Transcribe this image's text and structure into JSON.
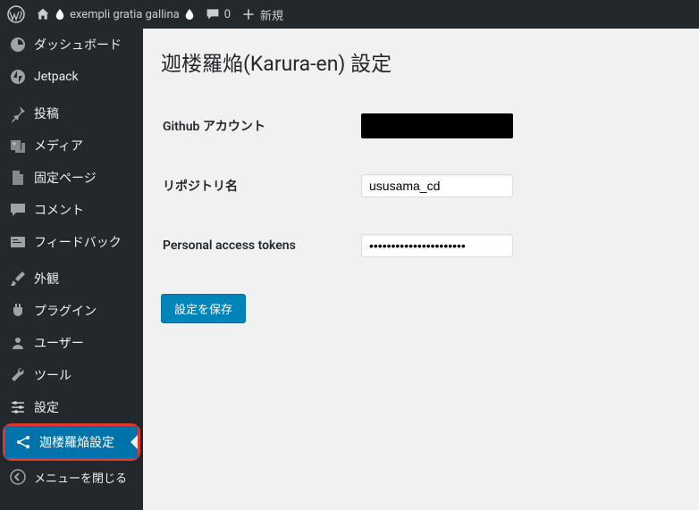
{
  "topbar": {
    "site_name": "exempli gratia gallina",
    "comments_count": "0",
    "new_label": "新規"
  },
  "sidebar": {
    "items": [
      {
        "label": "ダッシュボード"
      },
      {
        "label": "Jetpack"
      },
      {
        "label": "投稿"
      },
      {
        "label": "メディア"
      },
      {
        "label": "固定ページ"
      },
      {
        "label": "コメント"
      },
      {
        "label": "フィードバック"
      },
      {
        "label": "外観"
      },
      {
        "label": "プラグイン"
      },
      {
        "label": "ユーザー"
      },
      {
        "label": "ツール"
      },
      {
        "label": "設定"
      },
      {
        "label": "迦楼羅焔設定"
      }
    ],
    "collapse_label": "メニューを閉じる"
  },
  "main": {
    "title": "迦楼羅焔(Karura-en) 設定",
    "rows": {
      "github_label": "Github アカウント",
      "repo_label": "リポジトリ名",
      "repo_value": "ususama_cd",
      "token_label": "Personal access tokens",
      "token_value": "••••••••••••••••••••••"
    },
    "submit_label": "設定を保存"
  }
}
